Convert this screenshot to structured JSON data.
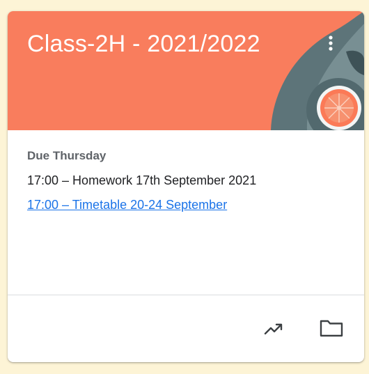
{
  "card": {
    "title": "Class-2H - 2021/2022",
    "banner_color": "#f97d5d",
    "more_icon": "more-vert-icon",
    "due_label": "Due Thursday",
    "assignments": [
      {
        "text": "17:00 – Homework 17th September 2021",
        "is_link": false
      },
      {
        "text": "17:00 – Timetable 20-24 September",
        "is_link": true
      }
    ],
    "footer_icons": [
      "trending-up-icon",
      "folder-icon"
    ]
  }
}
